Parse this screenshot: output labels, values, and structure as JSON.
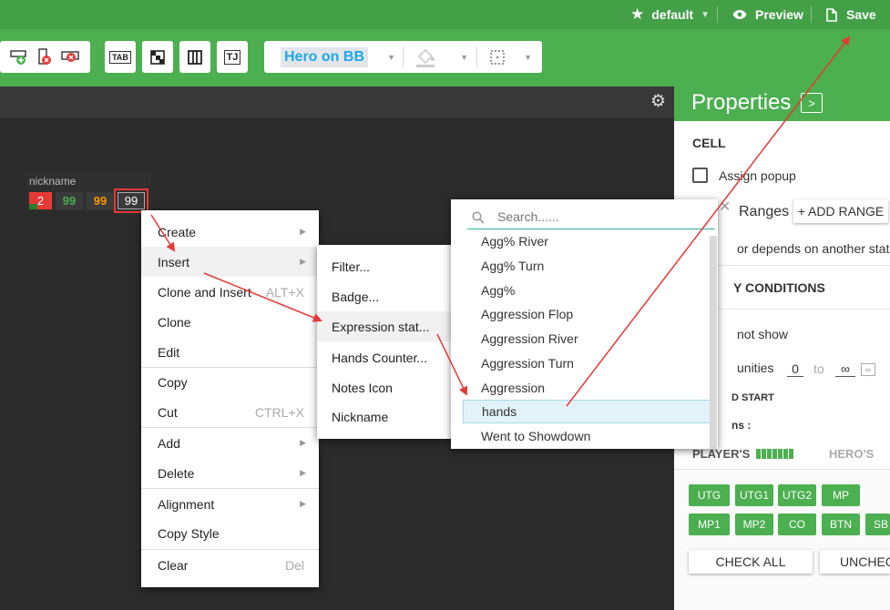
{
  "topbar": {
    "profile_label": "default",
    "preview_label": "Preview",
    "save_label": "Save"
  },
  "toolbar": {
    "tab_label": "TAB",
    "tj_label": "TJ",
    "view_select": "Hero on BB"
  },
  "hud": {
    "nickname": "nickname",
    "cells": [
      {
        "value": "2",
        "color": "#ffffff"
      },
      {
        "value": "99",
        "color": "#4caf50"
      },
      {
        "value": "99",
        "color": "#ff9800"
      },
      {
        "value": "99",
        "color": "#ffffff"
      }
    ]
  },
  "context_menu": {
    "items": [
      {
        "label": "Create",
        "submenu": true
      },
      {
        "label": "Insert",
        "submenu": true
      },
      {
        "label": "Clone and Insert",
        "shortcut": "ALT+X"
      },
      {
        "label": "Clone"
      },
      {
        "label": "Edit"
      },
      {
        "label": "Copy"
      },
      {
        "label": "Cut",
        "shortcut": "CTRL+X"
      },
      {
        "label": "Add",
        "submenu": true
      },
      {
        "label": "Delete",
        "submenu": true
      },
      {
        "label": "Alignment",
        "submenu": true
      },
      {
        "label": "Copy Style"
      },
      {
        "label": "Clear",
        "shortcut": "Del"
      }
    ]
  },
  "insert_submenu": {
    "items": [
      "Filter...",
      "Badge...",
      "Expression stat...",
      "Hands Counter...",
      "Notes Icon",
      "Nickname"
    ]
  },
  "stat_search": {
    "placeholder": "Search......",
    "items": [
      "Agg% River",
      "Agg% Turn",
      "Agg%",
      "Aggression Flop",
      "Aggression River",
      "Aggression Turn",
      "Aggression",
      "hands",
      "Went to Showdown"
    ],
    "selected": "hands"
  },
  "properties": {
    "title": "Properties",
    "cell_heading": "CELL",
    "assign_popup": "Assign popup",
    "ranges_label": "Ranges",
    "add_range": "+ ADD RANGE",
    "color_depends": "or depends on another stat",
    "conditions_heading": "Y CONDITIONS",
    "not_show": "not show",
    "opportunities": "unities",
    "opp_from": "0",
    "opp_to_label": "to",
    "opp_to": "∞",
    "start_label": "D START",
    "ns_label": "ns :",
    "players_label": "PLAYER'S",
    "heros_label": "HERO'S",
    "positions": [
      "UTG",
      "UTG1",
      "UTG2",
      "MP",
      "MP1",
      "MP2",
      "CO",
      "BTN",
      "SB"
    ],
    "check_all": "CHECK ALL",
    "uncheck_all": "UNCHECK ALL"
  },
  "colors": {
    "accent": "#4caf50",
    "topbar": "#43a047",
    "annotation_arrow": "#e53935"
  }
}
